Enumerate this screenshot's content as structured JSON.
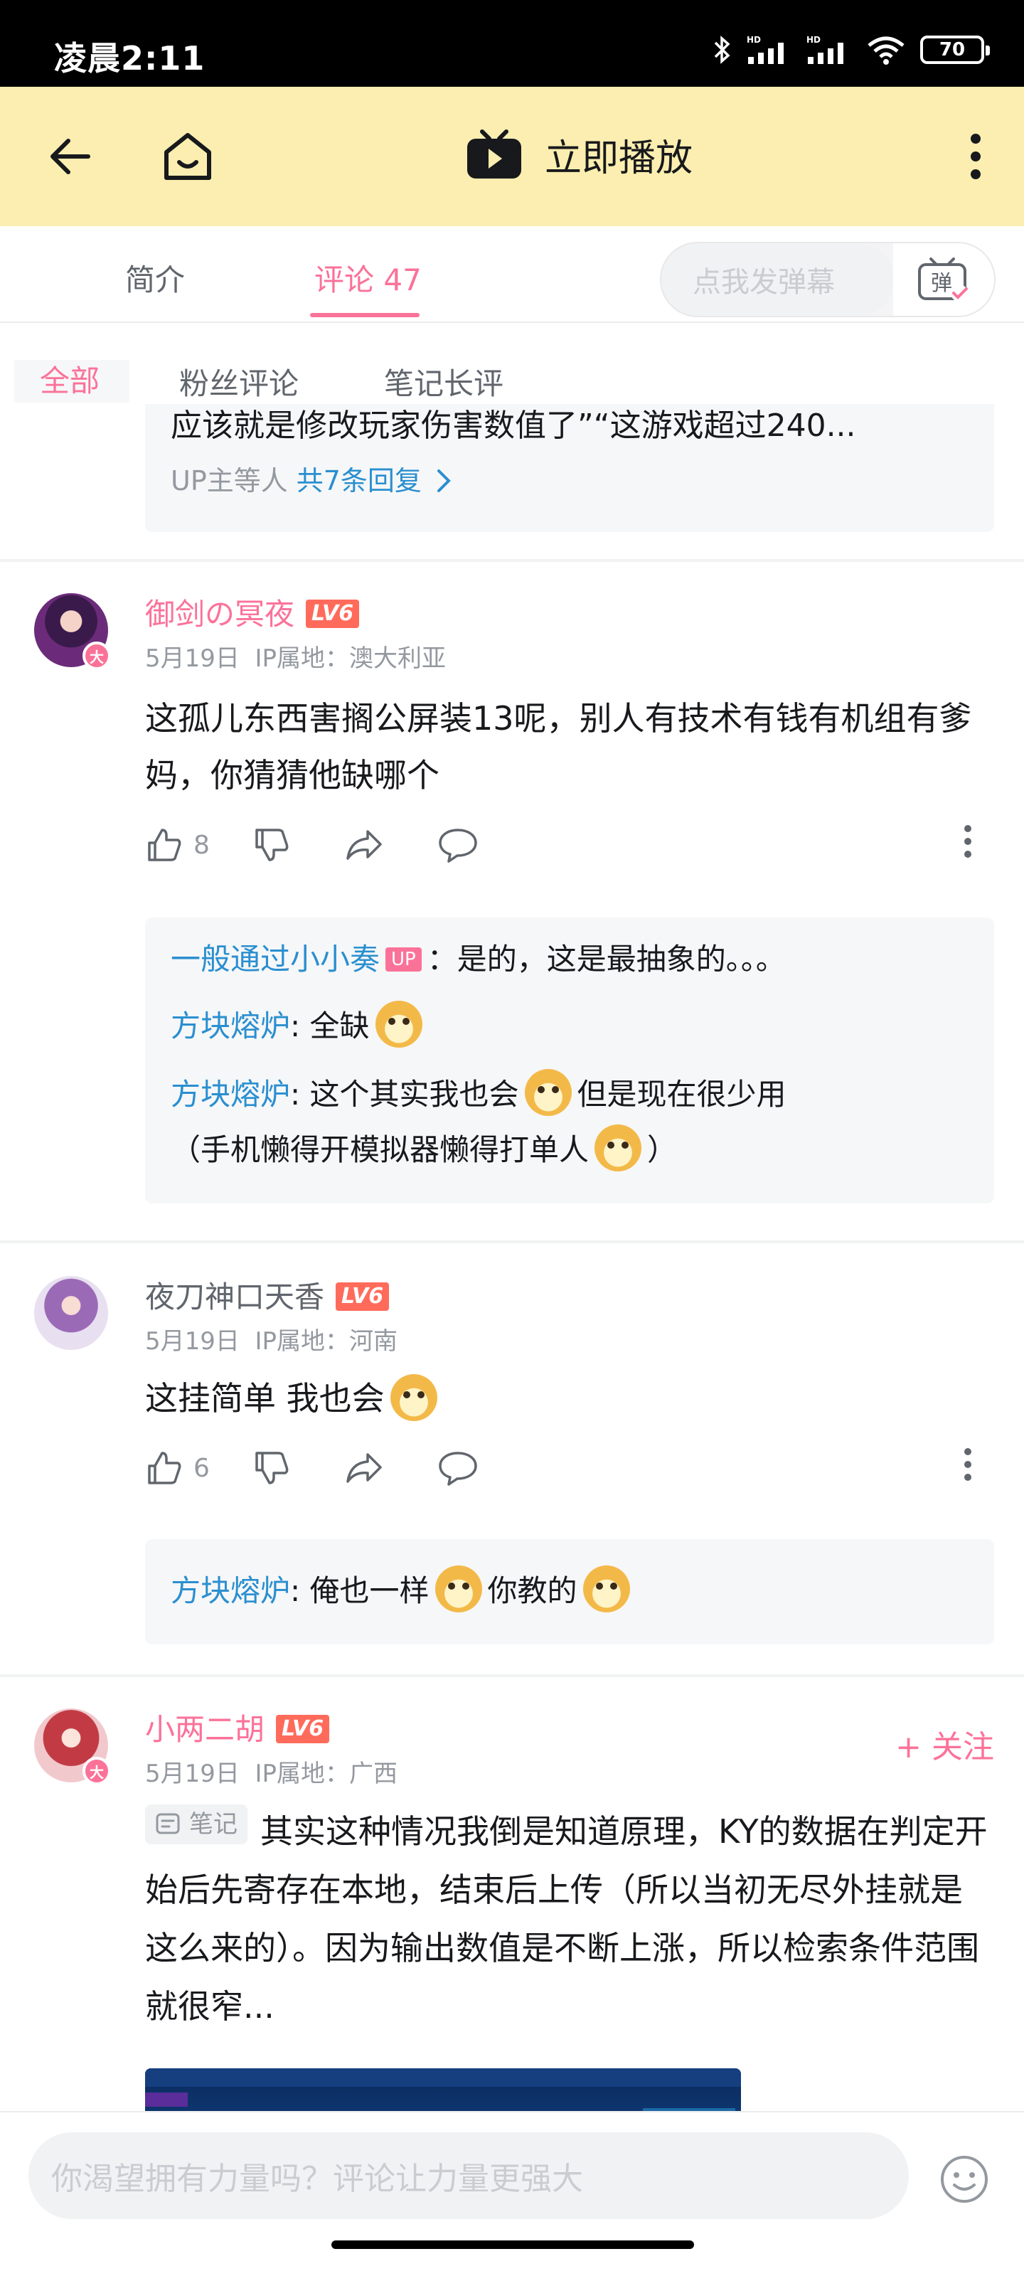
{
  "status_bar": {
    "time": "凌晨2:11",
    "battery": "70"
  },
  "top_bar": {
    "play_label": "立即播放"
  },
  "tabs": [
    {
      "label": "简介"
    },
    {
      "label": "评论 47"
    }
  ],
  "danmaku": {
    "placeholder": "点我发弹幕",
    "button_label": "弹"
  },
  "filters": [
    {
      "label": "全部"
    },
    {
      "label": "粉丝评论"
    },
    {
      "label": "笔记长评"
    }
  ],
  "prev_comment": {
    "text_tail": "应该就是修改玩家伤害数值了”“这游戏超过240...",
    "reply_prefix": "UP主等人",
    "reply_count_label": "共7条回复"
  },
  "comments": [
    {
      "username": "御剑の冥夜",
      "level": "LV6",
      "date": "5月19日",
      "ip": "IP属地：澳大利亚",
      "text": "这孤儿东西害搁公屏装13呢，别人有技术有钱有机组有爹妈，你猜猜他缺哪个",
      "likes": "8",
      "replies": [
        {
          "name": "一般通过小小奏",
          "up_tag": "UP",
          "text": "：是的，这是最抽象的。。。"
        },
        {
          "name": "方块熔炉",
          "text": ": 全缺"
        },
        {
          "name": "方块熔炉",
          "text": ": 这个其实我也会",
          "text2": "但是现在很少用",
          "text3": "（手机懒得开模拟器懒得打单人",
          "text4": "）"
        }
      ]
    },
    {
      "username": "夜刀神口天香",
      "level": "LV6",
      "date": "5月19日",
      "ip": "IP属地：河南",
      "text": "这挂简单 我也会",
      "likes": "6",
      "replies": [
        {
          "name": "方块熔炉",
          "text": ": 俺也一样",
          "text2": "你教的"
        }
      ]
    },
    {
      "username": "小两二胡",
      "level": "LV6",
      "date": "5月19日",
      "ip": "IP属地：广西",
      "follow_label": "+ 关注",
      "note_tag": "笔记",
      "text": "其实这种情况我倒是知道原理，KY的数据在判定开始后先寄存在本地，结束后上传（所以当初无尽外挂就是这么来的）。因为输出数值是不断上涨，所以检索条件范围就很窄..."
    }
  ],
  "bottom_input": {
    "placeholder": "你渴望拥有力量吗？评论让力量更强大"
  },
  "colors": {
    "accent": "#fb7299",
    "app_bar": "#fbeeb0",
    "reply_name": "#2a8fd0"
  }
}
